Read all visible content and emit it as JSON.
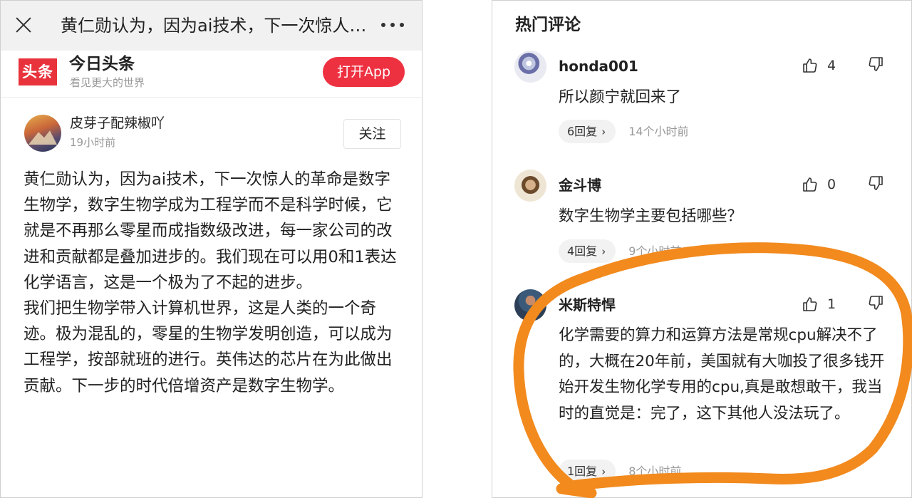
{
  "left_panel": {
    "topbar": {
      "title": "黄仁勋认为，因为ai技术，下一次惊人的革命是数字生物学",
      "close_icon": "close-icon",
      "more_icon": "more-dots-icon"
    },
    "brand": {
      "logo_text": "头条",
      "app_name": "今日头条",
      "slogan": "看见更大的世界",
      "open_app_label": "打开App"
    },
    "author": {
      "name": "皮芽子配辣椒吖",
      "time": "19小时前",
      "follow_label": "关注"
    },
    "article": {
      "paragraph1": "黄仁勋认为，因为ai技术，下一次惊人的革命是数字生物学，数字生物学成为工程学而不是科学时候，它就是不再那么零星而成指数级改进，每一家公司的改进和贡献都是叠加进步的。我们现在可以用0和1表达化学语言，这是一个极为了不起的进步。",
      "paragraph2": "我们把生物学带入计算机世界，这是人类的一个奇迹。极为混乱的，零星的生物学发明创造，可以成为工程学，按部就班的进行。英伟达的芯片在为此做出贡献。下一步的时代倍增资产是数字生物学。"
    }
  },
  "right_panel": {
    "section_title": "热门评论",
    "comments": [
      {
        "user": "honda001",
        "likes": "4",
        "text": "所以颜宁就回来了",
        "replies": "6回复",
        "time": "14个小时前"
      },
      {
        "user": "金斗博",
        "likes": "0",
        "text": "数字生物学主要包括哪些？",
        "replies": "4回复",
        "time": "9个小时前"
      },
      {
        "user": "米斯特悍",
        "likes": "1",
        "text": "化学需要的算力和运算方法是常规cpu解决不了的，大概在20年前，美国就有大咖投了很多钱开始开发生物化学专用的cpu,真是敢想敢干，我当时的直觉是：完了，这下其他人没法玩了。",
        "replies": "1回复",
        "time": "8个小时前"
      }
    ],
    "icons": {
      "like": "thumbs-up-icon",
      "dislike": "thumbs-down-icon",
      "chevron": "chevron-right-icon"
    },
    "highlight_color": "#f28a1e"
  }
}
